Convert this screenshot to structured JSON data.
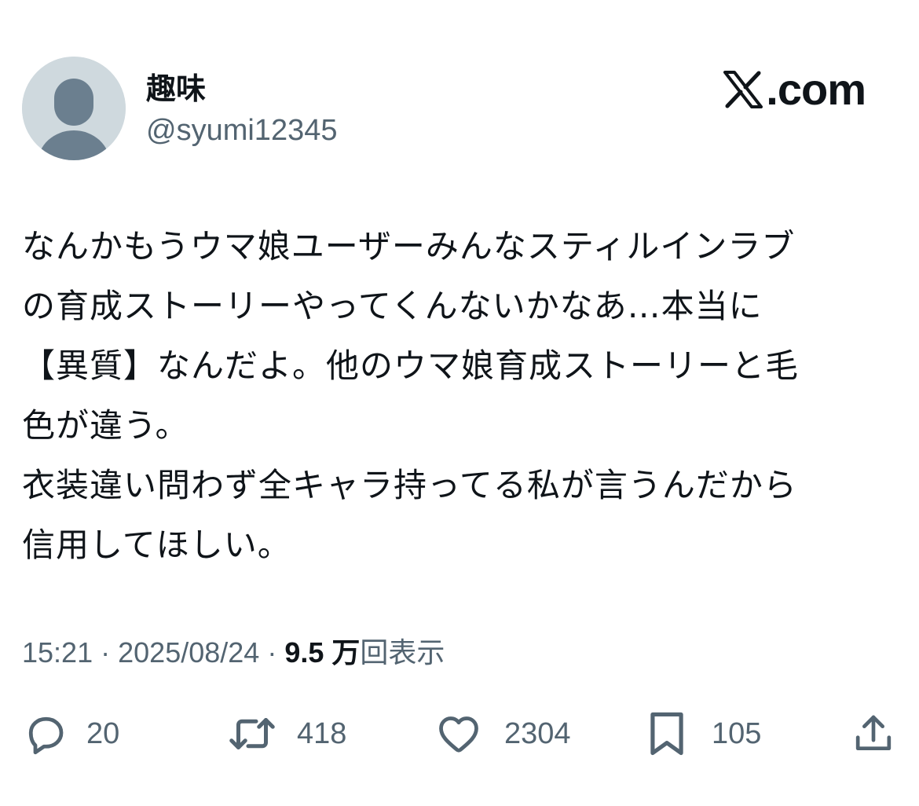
{
  "user": {
    "display_name": "趣味",
    "handle": "@syumi12345",
    "avatar_icon": "default-avatar-silhouette-icon"
  },
  "brand": {
    "logo_icon": "x-logo-icon",
    "domain_suffix": ".com"
  },
  "tweet": {
    "lines": [
      "なんかもうウマ娘ユーザーみんなスティルインラブ",
      "の育成ストーリーやってくんないかなあ…本当に",
      "【異質】なんだよ。他のウマ娘育成ストーリーと毛",
      "色が違う。",
      "衣装違い問わず全キャラ持ってる私が言うんだから",
      "信用してほしい。"
    ]
  },
  "meta": {
    "time": "15:21",
    "separator": "·",
    "date": "2025/08/24",
    "views_count": "9.5 万",
    "views_label": "回表示"
  },
  "actions": {
    "reply_count": "20",
    "retweet_count": "418",
    "like_count": "2304",
    "bookmark_count": "105"
  },
  "colors": {
    "text_primary": "#0f1419",
    "text_secondary": "#536471",
    "avatar_bg": "#cfd9de"
  }
}
